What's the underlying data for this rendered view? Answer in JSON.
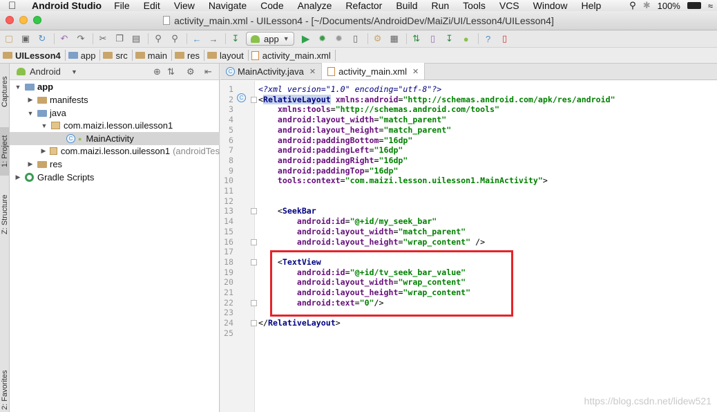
{
  "menubar": {
    "app_name": "Android Studio",
    "items": [
      "File",
      "Edit",
      "View",
      "Navigate",
      "Code",
      "Analyze",
      "Refactor",
      "Build",
      "Run",
      "Tools",
      "VCS",
      "Window",
      "Help"
    ],
    "battery": "100%"
  },
  "window": {
    "title": "activity_main.xml - UILesson4 - [~/Documents/AndroidDev/MaiZi/UI/Lesson4/UILesson4]"
  },
  "toolbar": {
    "run_config": "app"
  },
  "breadcrumb": [
    "UILesson4",
    "app",
    "src",
    "main",
    "res",
    "layout",
    "activity_main.xml"
  ],
  "side_tabs": {
    "captures": "Captures",
    "project": "1: Project",
    "structure": "Z: Structure",
    "favorites": "2: Favorites"
  },
  "project_panel": {
    "view_mode": "Android",
    "tree": [
      {
        "label": "app",
        "level": 0,
        "expanded": true
      },
      {
        "label": "manifests",
        "level": 1,
        "expanded": false
      },
      {
        "label": "java",
        "level": 1,
        "expanded": true
      },
      {
        "label": "com.maizi.lesson.uilesson1",
        "level": 2,
        "expanded": true
      },
      {
        "label": "MainActivity",
        "level": 3,
        "selected": true
      },
      {
        "label": "com.maizi.lesson.uilesson1",
        "note": "(androidTes",
        "level": 2,
        "expanded": false
      },
      {
        "label": "res",
        "level": 1,
        "expanded": false
      },
      {
        "label": "Gradle Scripts",
        "level": 0,
        "expanded": false
      }
    ]
  },
  "editor": {
    "tabs": [
      {
        "label": "MainActivity.java",
        "active": false
      },
      {
        "label": "activity_main.xml",
        "active": true
      }
    ],
    "code_lines": [
      {
        "n": "1",
        "parts": [
          [
            "pi",
            "<?xml version=\"1.0\" encoding=\"utf-8\"?>"
          ]
        ]
      },
      {
        "n": "2",
        "parts": [
          [
            "t",
            "<"
          ],
          [
            "hl",
            "RelativeLayout"
          ],
          [
            "t",
            " "
          ],
          [
            "attr",
            "xmlns:android"
          ],
          [
            "t",
            "="
          ],
          [
            "val",
            "\"http://schemas.android.com/apk/res/android\""
          ]
        ]
      },
      {
        "n": "3",
        "parts": [
          [
            "t",
            "    "
          ],
          [
            "attr",
            "xmlns:tools"
          ],
          [
            "t",
            "="
          ],
          [
            "val",
            "\"http://schemas.android.com/tools\""
          ]
        ]
      },
      {
        "n": "4",
        "parts": [
          [
            "t",
            "    "
          ],
          [
            "attr",
            "android:layout_width"
          ],
          [
            "t",
            "="
          ],
          [
            "val",
            "\"match_parent\""
          ]
        ]
      },
      {
        "n": "5",
        "parts": [
          [
            "t",
            "    "
          ],
          [
            "attr",
            "android:layout_height"
          ],
          [
            "t",
            "="
          ],
          [
            "val",
            "\"match_parent\""
          ]
        ]
      },
      {
        "n": "6",
        "parts": [
          [
            "t",
            "    "
          ],
          [
            "attr",
            "android:paddingBottom"
          ],
          [
            "t",
            "="
          ],
          [
            "val",
            "\"16dp\""
          ]
        ]
      },
      {
        "n": "7",
        "parts": [
          [
            "t",
            "    "
          ],
          [
            "attr",
            "android:paddingLeft"
          ],
          [
            "t",
            "="
          ],
          [
            "val",
            "\"16dp\""
          ]
        ]
      },
      {
        "n": "8",
        "parts": [
          [
            "t",
            "    "
          ],
          [
            "attr",
            "android:paddingRight"
          ],
          [
            "t",
            "="
          ],
          [
            "val",
            "\"16dp\""
          ]
        ]
      },
      {
        "n": "9",
        "parts": [
          [
            "t",
            "    "
          ],
          [
            "attr",
            "android:paddingTop"
          ],
          [
            "t",
            "="
          ],
          [
            "val",
            "\"16dp\""
          ]
        ]
      },
      {
        "n": "10",
        "parts": [
          [
            "t",
            "    "
          ],
          [
            "attr",
            "tools:context"
          ],
          [
            "t",
            "="
          ],
          [
            "val",
            "\"com.maizi.lesson.uilesson1.MainActivity\""
          ],
          [
            "t",
            ">"
          ]
        ]
      },
      {
        "n": "11",
        "parts": []
      },
      {
        "n": "12",
        "parts": []
      },
      {
        "n": "13",
        "parts": [
          [
            "t",
            "    <"
          ],
          [
            "tag",
            "SeekBar"
          ]
        ]
      },
      {
        "n": "14",
        "parts": [
          [
            "t",
            "        "
          ],
          [
            "attr",
            "android:id"
          ],
          [
            "t",
            "="
          ],
          [
            "val",
            "\"@+id/my_seek_bar\""
          ]
        ]
      },
      {
        "n": "15",
        "parts": [
          [
            "t",
            "        "
          ],
          [
            "attr",
            "android:layout_width"
          ],
          [
            "t",
            "="
          ],
          [
            "val",
            "\"match_parent\""
          ]
        ]
      },
      {
        "n": "16",
        "parts": [
          [
            "t",
            "        "
          ],
          [
            "attr",
            "android:layout_height"
          ],
          [
            "t",
            "="
          ],
          [
            "val",
            "\"wrap_content\""
          ],
          [
            "t",
            " />"
          ]
        ]
      },
      {
        "n": "17",
        "parts": []
      },
      {
        "n": "18",
        "parts": [
          [
            "t",
            "    <"
          ],
          [
            "tag",
            "TextView"
          ]
        ]
      },
      {
        "n": "19",
        "parts": [
          [
            "t",
            "        "
          ],
          [
            "attr",
            "android:id"
          ],
          [
            "t",
            "="
          ],
          [
            "val",
            "\"@+id/tv_seek_bar_value\""
          ]
        ]
      },
      {
        "n": "20",
        "parts": [
          [
            "t",
            "        "
          ],
          [
            "attr",
            "android:layout_width"
          ],
          [
            "t",
            "="
          ],
          [
            "val",
            "\"wrap_content\""
          ]
        ]
      },
      {
        "n": "21",
        "parts": [
          [
            "t",
            "        "
          ],
          [
            "attr",
            "android:layout_height"
          ],
          [
            "t",
            "="
          ],
          [
            "val",
            "\"wrap_content\""
          ]
        ]
      },
      {
        "n": "22",
        "parts": [
          [
            "t",
            "        "
          ],
          [
            "attr",
            "android:text"
          ],
          [
            "t",
            "="
          ],
          [
            "val",
            "\"0\""
          ],
          [
            "t",
            "/>"
          ]
        ]
      },
      {
        "n": "23",
        "parts": []
      },
      {
        "n": "24",
        "parts": [
          [
            "t",
            "</"
          ],
          [
            "tag",
            "RelativeLayout"
          ],
          [
            "t",
            ">"
          ]
        ]
      },
      {
        "n": "25",
        "parts": []
      }
    ]
  },
  "watermark": "https://blog.csdn.net/lidew521",
  "colors": {
    "highlight_box": "#e52329",
    "xml_tag": "#000080",
    "xml_attr": "#660e7a",
    "xml_value": "#008000"
  }
}
